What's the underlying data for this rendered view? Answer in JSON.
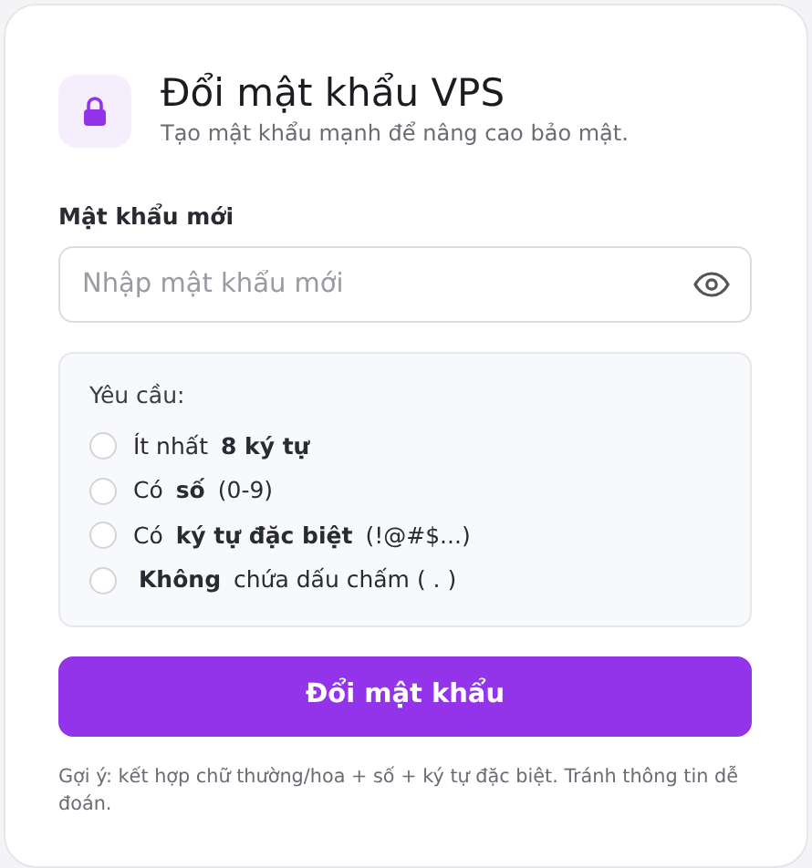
{
  "header": {
    "title": "Đổi mật khẩu VPS",
    "subtitle": "Tạo mật khẩu mạnh để nâng cao bảo mật."
  },
  "password_field": {
    "label": "Mật khẩu mới",
    "placeholder": "Nhập mật khẩu mới"
  },
  "requirements": {
    "title": "Yêu cầu:",
    "items": [
      {
        "text": "Ít nhất **8 ký tự**",
        "checked": false
      },
      {
        "text": "Có **số** (0-9)",
        "checked": false
      },
      {
        "text": "Có **ký tự đặc biệt** (!@#$...)",
        "checked": false
      },
      {
        "text": "**Không** chứa dấu chấm ( . )",
        "checked": false
      }
    ]
  },
  "submit_button": "Đổi mật khẩu",
  "hint": "Gợi ý: kết hợp chữ thường/hoa + số + ký tự đặc biệt. Tránh thông tin dễ đoán."
}
